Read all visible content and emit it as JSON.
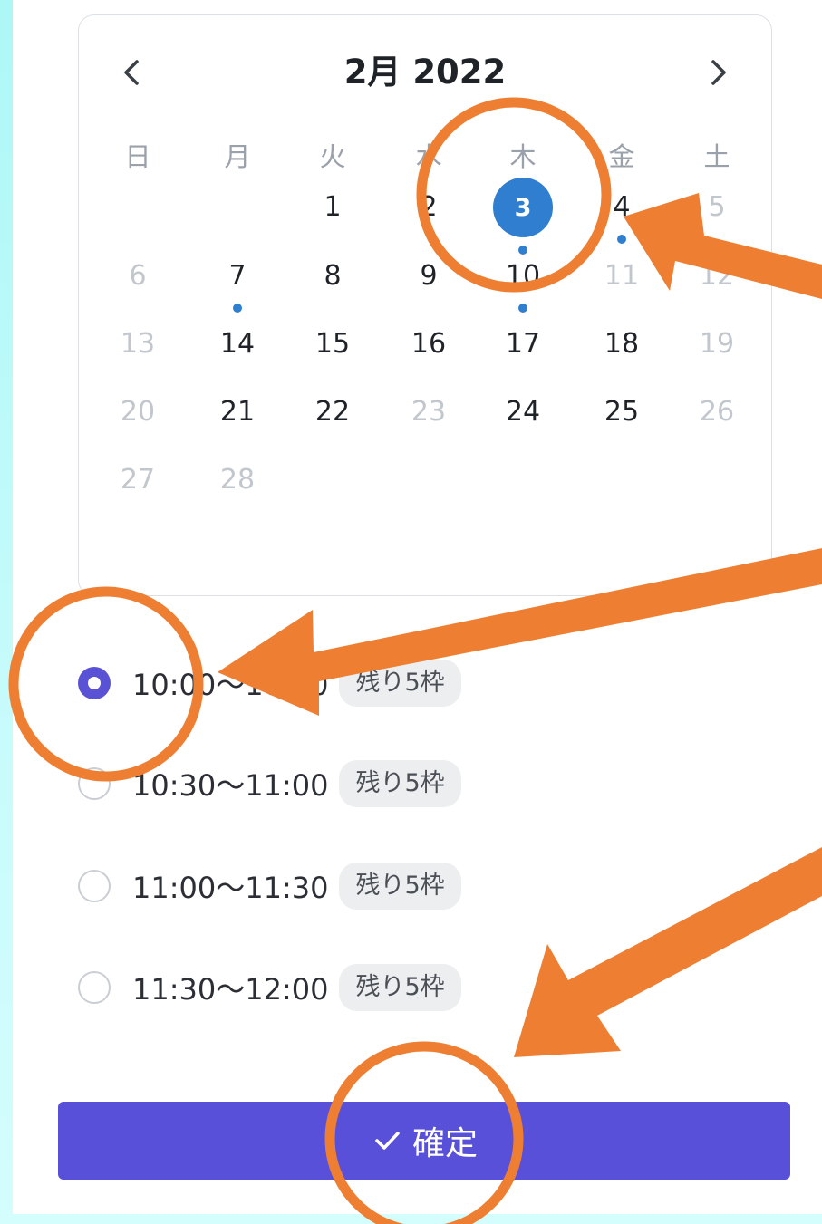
{
  "calendar": {
    "month_title": "2月 2022",
    "prev_icon": "chevron-left-icon",
    "next_icon": "chevron-right-icon",
    "weekdays": [
      "日",
      "月",
      "火",
      "水",
      "木",
      "金",
      "土"
    ],
    "days": [
      {
        "label": "1",
        "state": "available"
      },
      {
        "label": "2",
        "state": "available"
      },
      {
        "label": "3",
        "state": "selected"
      },
      {
        "label": "4",
        "state": "available",
        "has_event": true
      },
      {
        "label": "5",
        "state": "disabled"
      },
      {
        "label": "6",
        "state": "disabled"
      },
      {
        "label": "7",
        "state": "available",
        "has_event": true
      },
      {
        "label": "8",
        "state": "available"
      },
      {
        "label": "9",
        "state": "available"
      },
      {
        "label": "10",
        "state": "available",
        "has_event": true
      },
      {
        "label": "11",
        "state": "disabled"
      },
      {
        "label": "12",
        "state": "disabled"
      },
      {
        "label": "13",
        "state": "disabled"
      },
      {
        "label": "14",
        "state": "available"
      },
      {
        "label": "15",
        "state": "available"
      },
      {
        "label": "16",
        "state": "available"
      },
      {
        "label": "17",
        "state": "available"
      },
      {
        "label": "18",
        "state": "available"
      },
      {
        "label": "19",
        "state": "disabled"
      },
      {
        "label": "20",
        "state": "disabled"
      },
      {
        "label": "21",
        "state": "available"
      },
      {
        "label": "22",
        "state": "available"
      },
      {
        "label": "23",
        "state": "disabled"
      },
      {
        "label": "24",
        "state": "available"
      },
      {
        "label": "25",
        "state": "available"
      },
      {
        "label": "26",
        "state": "disabled"
      },
      {
        "label": "27",
        "state": "disabled"
      },
      {
        "label": "28",
        "state": "disabled"
      }
    ]
  },
  "time_slots": [
    {
      "time": "10:00〜10:30",
      "badge": "残り5枠",
      "selected": true
    },
    {
      "time": "10:30〜11:00",
      "badge": "残り5枠",
      "selected": false
    },
    {
      "time": "11:00〜11:30",
      "badge": "残り5枠",
      "selected": false
    },
    {
      "time": "11:30〜12:00",
      "badge": "残り5枠",
      "selected": false
    }
  ],
  "confirm_button": {
    "label": "確定",
    "icon": "checkmark-icon"
  },
  "colors": {
    "accent": "#5850d8",
    "selected_day": "#2f7ed0",
    "annotation": "#ee7f32",
    "background": "#aef7f7"
  }
}
